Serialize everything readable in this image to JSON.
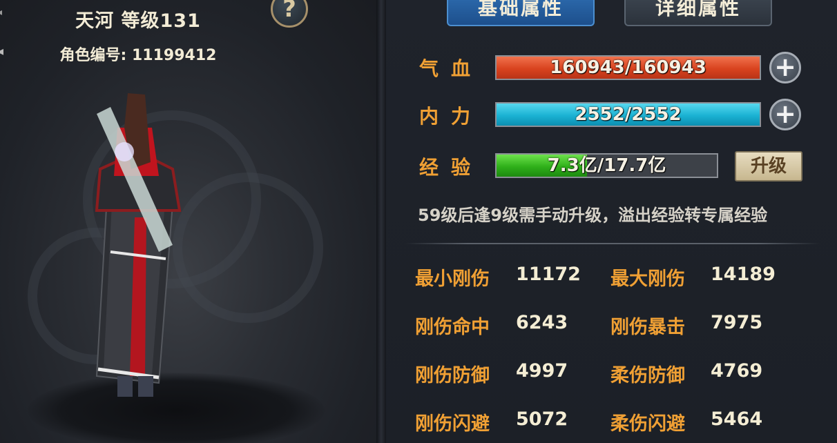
{
  "character": {
    "name_level": "天河 等级131",
    "id_label": "角色编号:",
    "id_value": "11199412",
    "help_icon": "question-mark-icon"
  },
  "tabs": [
    {
      "label": "基础属性",
      "active": true
    },
    {
      "label": "详细属性",
      "active": false
    }
  ],
  "bars": {
    "hp": {
      "label": "气血",
      "text": "160943/160943",
      "fraction": 1.0,
      "color": "#d9431f"
    },
    "mp": {
      "label": "内力",
      "text": "2552/2552",
      "fraction": 1.0,
      "color": "#1ab2d3"
    },
    "exp": {
      "label": "经验",
      "text": "7.3亿/17.7亿",
      "fraction": 0.412,
      "color": "#2fb01a"
    }
  },
  "levelup_label": "升级",
  "exp_note": "59级后逢9级需手动升级，溢出经验转专属经验",
  "attributes": [
    {
      "name": "最小刚伤",
      "value": "11172"
    },
    {
      "name": "最大刚伤",
      "value": "14189"
    },
    {
      "name": "刚伤命中",
      "value": "6243"
    },
    {
      "name": "刚伤暴击",
      "value": "7975"
    },
    {
      "name": "刚伤防御",
      "value": "4997"
    },
    {
      "name": "柔伤防御",
      "value": "4769"
    },
    {
      "name": "刚伤闪避",
      "value": "5072"
    },
    {
      "name": "柔伤闪避",
      "value": "5464"
    }
  ],
  "colors": {
    "label_orange": "#f0a034",
    "value_cream": "#f4edd4",
    "tab_active": "#2f6fb3"
  }
}
